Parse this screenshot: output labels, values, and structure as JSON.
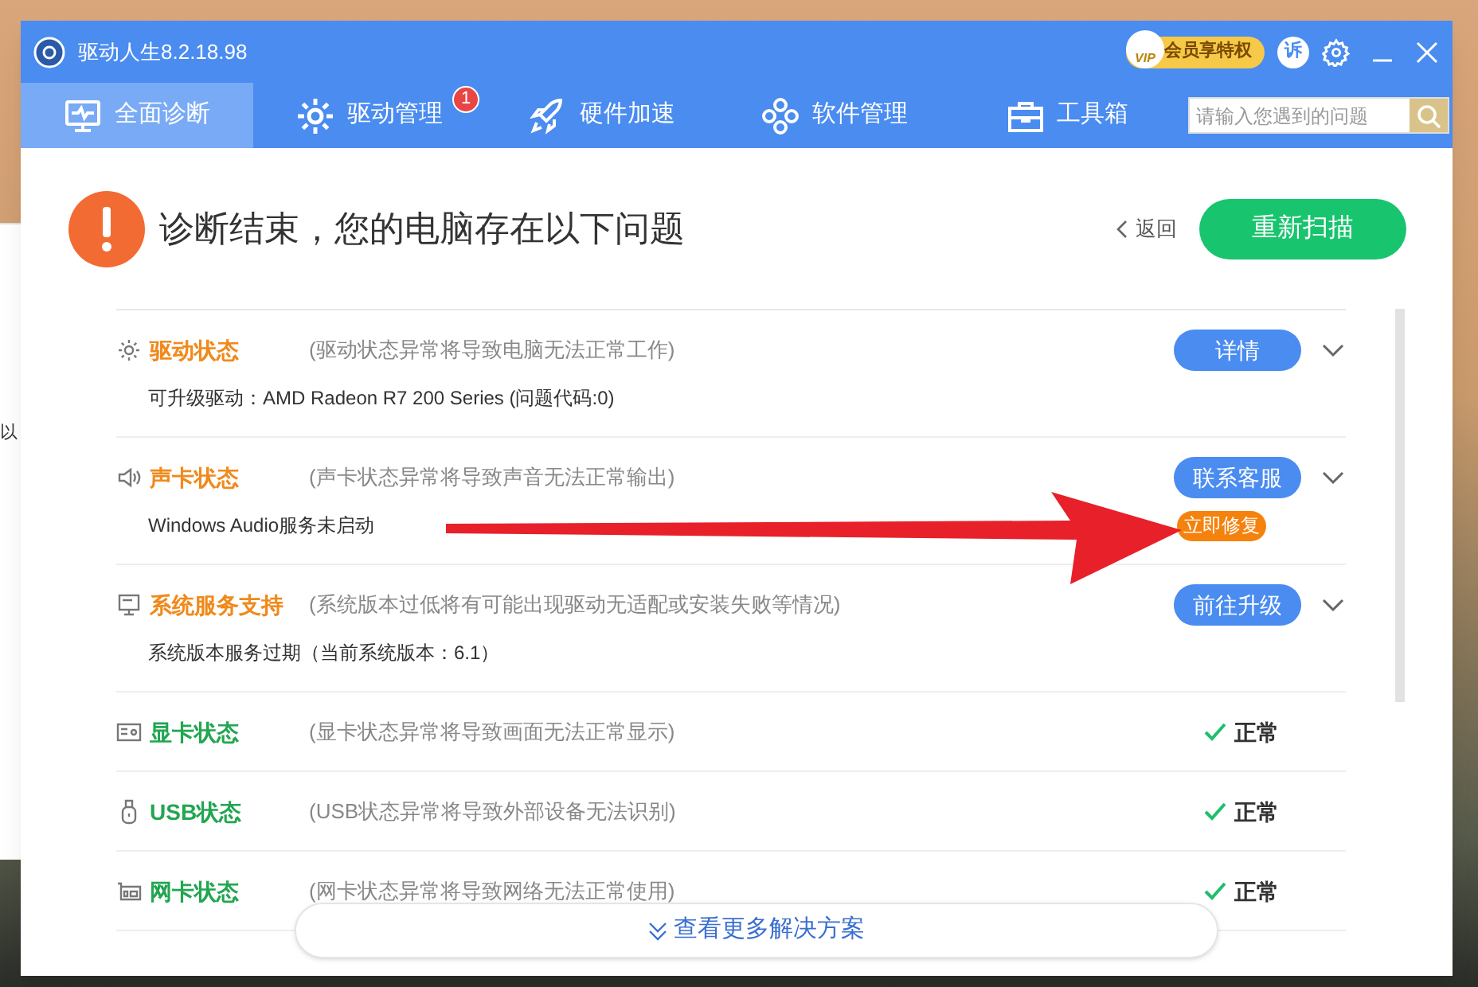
{
  "background": {
    "window_text": "以"
  },
  "window": {
    "title": "驱动人生8.2.18.98",
    "vip_label": "会员享特权",
    "vip_badge": "VIP",
    "complaint_label": "诉"
  },
  "tabs": [
    {
      "label": "全面诊断",
      "selected": true
    },
    {
      "label": "驱动管理",
      "selected": false,
      "badge": "1"
    },
    {
      "label": "硬件加速",
      "selected": false
    },
    {
      "label": "软件管理",
      "selected": false
    },
    {
      "label": "工具箱",
      "selected": false
    }
  ],
  "search": {
    "placeholder": "请输入您遇到的问题"
  },
  "header": {
    "title": "诊断结束，您的电脑存在以下问题",
    "back": "返回",
    "rescan": "重新扫描"
  },
  "items": [
    {
      "kind": "problem",
      "title": "驱动状态",
      "description": "(驱动状态异常将导致电脑无法正常工作)",
      "action": "详情",
      "detail": "可升级驱动：AMD Radeon R7 200 Series (问题代码:0)"
    },
    {
      "kind": "problem",
      "title": "声卡状态",
      "description": "(声卡状态异常将导致声音无法正常输出)",
      "action": "联系客服",
      "detail": "Windows Audio服务未启动",
      "fix": "立即修复"
    },
    {
      "kind": "problem",
      "title": "系统服务支持",
      "description": "(系统版本过低将有可能出现驱动无适配或安装失败等情况)",
      "action": "前往升级",
      "detail": "系统版本服务过期（当前系统版本：6.1）"
    },
    {
      "kind": "ok",
      "title": "显卡状态",
      "description": "(显卡状态异常将导致画面无法正常显示)",
      "status": "正常"
    },
    {
      "kind": "ok",
      "title": "USB状态",
      "description": "(USB状态异常将导致外部设备无法识别)",
      "status": "正常"
    },
    {
      "kind": "ok",
      "title": "网卡状态",
      "description": "(网卡状态异常将导致网络无法正常使用)",
      "status": "正常"
    }
  ],
  "more_button": "查看更多解决方案"
}
